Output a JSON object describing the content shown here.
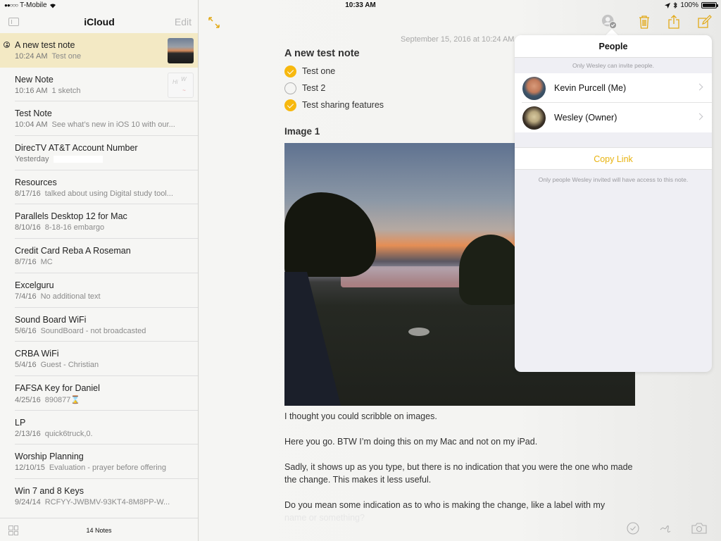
{
  "status_bar": {
    "signal": "●●○○○",
    "carrier": "T-Mobile",
    "time": "10:33 AM",
    "battery": "100%",
    "battery_level": 1.0
  },
  "sidebar": {
    "title": "iCloud",
    "edit_label": "Edit",
    "notes_count": "14 Notes",
    "notes": [
      {
        "title": "A new test note",
        "date": "10:24 AM",
        "preview": "Test one",
        "selected": true,
        "shared": true,
        "thumbnail": "photo"
      },
      {
        "title": "New Note",
        "date": "10:16 AM",
        "preview": "1 sketch",
        "thumbnail": "sketch"
      },
      {
        "title": "Test Note",
        "date": "10:04 AM",
        "preview": "See what’s new in iOS 10 with our..."
      },
      {
        "title": "DirecTV AT&T Account Number",
        "date": "Yesterday",
        "preview": "",
        "redacted": true
      },
      {
        "title": "Resources",
        "date": "8/17/16",
        "preview": "talked about using Digital study tool..."
      },
      {
        "title": "Parallels Desktop 12 for Mac",
        "date": "8/10/16",
        "preview": "8-18-16 embargo"
      },
      {
        "title": "Credit Card Reba A Roseman",
        "date": "8/7/16",
        "preview": "MC"
      },
      {
        "title": "Excelguru",
        "date": "7/4/16",
        "preview": "No additional text"
      },
      {
        "title": "Sound Board WiFi",
        "date": "5/6/16",
        "preview": "SoundBoard - not broadcasted"
      },
      {
        "title": "CRBA WiFi",
        "date": "5/4/16",
        "preview": "Guest - Christian"
      },
      {
        "title": "FAFSA Key for Daniel",
        "date": "4/25/16",
        "preview": "890877⌛"
      },
      {
        "title": "LP",
        "date": "2/13/16",
        "preview": "quick6truck,0."
      },
      {
        "title": "Worship Planning",
        "date": "12/10/15",
        "preview": "Evaluation - prayer before offering"
      },
      {
        "title": "Win 7 and 8 Keys",
        "date": "9/24/14",
        "preview": "RCFYY-JWBMV-93KT4-8M8PP-W..."
      }
    ]
  },
  "toolbar": {
    "icons": [
      "expand-icon",
      "people-icon",
      "trash-icon",
      "share-icon",
      "compose-icon"
    ],
    "accent_color": "#e2a916"
  },
  "note": {
    "timestamp": "September 15, 2016 at 10:24 AM",
    "title": "A new test note",
    "checklist": [
      {
        "text": "Test one",
        "checked": true
      },
      {
        "text": "Test 2",
        "checked": false
      },
      {
        "text": "Test sharing features",
        "checked": true
      }
    ],
    "image_heading": "Image 1",
    "paragraphs": [
      "I thought you could scribble on images.",
      "Here you go. BTW I’m doing this on my Mac and not on my iPad.",
      "Sadly, it shows up as you type, but there is no indication that you were the one who made the change. This makes it less useful.",
      "Do you mean some indication as to who is making the change, like a label with my",
      "name or something?"
    ]
  },
  "bottom_toolbar": {
    "icons": [
      "checklist-icon",
      "sketch-icon",
      "camera-icon"
    ]
  },
  "people_popover": {
    "title": "People",
    "invite_note": "Only Wesley can invite people.",
    "people": [
      {
        "name": "Kevin Purcell (Me)"
      },
      {
        "name": "Wesley (Owner)"
      }
    ],
    "copy_link_label": "Copy Link",
    "access_note": "Only people Wesley invited will have access to this note."
  }
}
